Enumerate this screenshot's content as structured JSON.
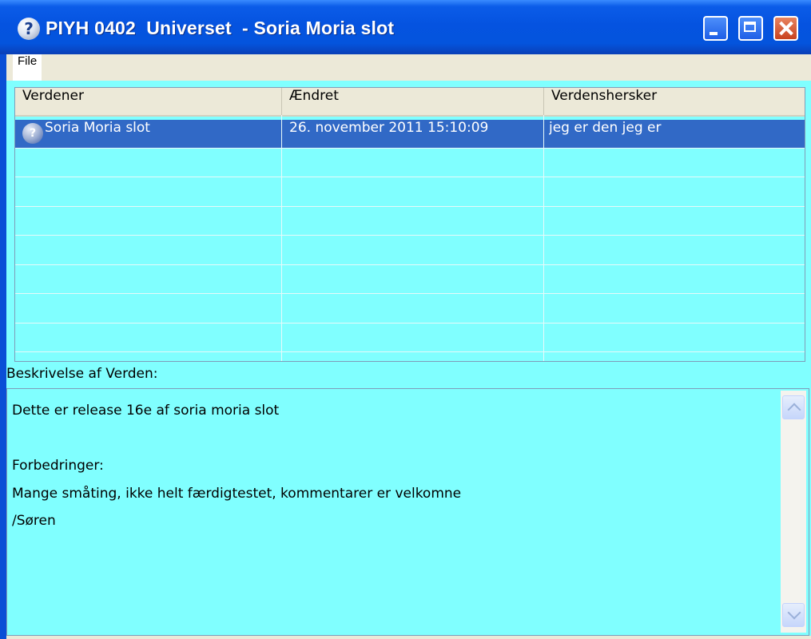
{
  "window": {
    "title": "PIYH 0402  Universet  - Soria Moria slot",
    "title_icon": "question-icon",
    "controls": [
      "minimize",
      "maximize",
      "close"
    ]
  },
  "menu": {
    "items": [
      {
        "label": "File"
      }
    ]
  },
  "list": {
    "columns": [
      "Verdener",
      "Ændret",
      "Verdenshersker"
    ],
    "rows": [
      {
        "icon": "question-icon",
        "name": "Soria Moria slot",
        "changed": "26. november 2011 15:10:09",
        "ruler": "jeg er den jeg er",
        "selected": true
      }
    ]
  },
  "description": {
    "label": "Beskrivelse af Verden:",
    "text": "Dette er release 16e af soria moria slot\n\nForbedringer:\nMange småting, ikke helt færdigtestet, kommentarer er velkomne\n/Søren"
  },
  "colors": {
    "titlebar": "#0553e0",
    "background": "#80ffff",
    "selection": "#3169c6"
  }
}
